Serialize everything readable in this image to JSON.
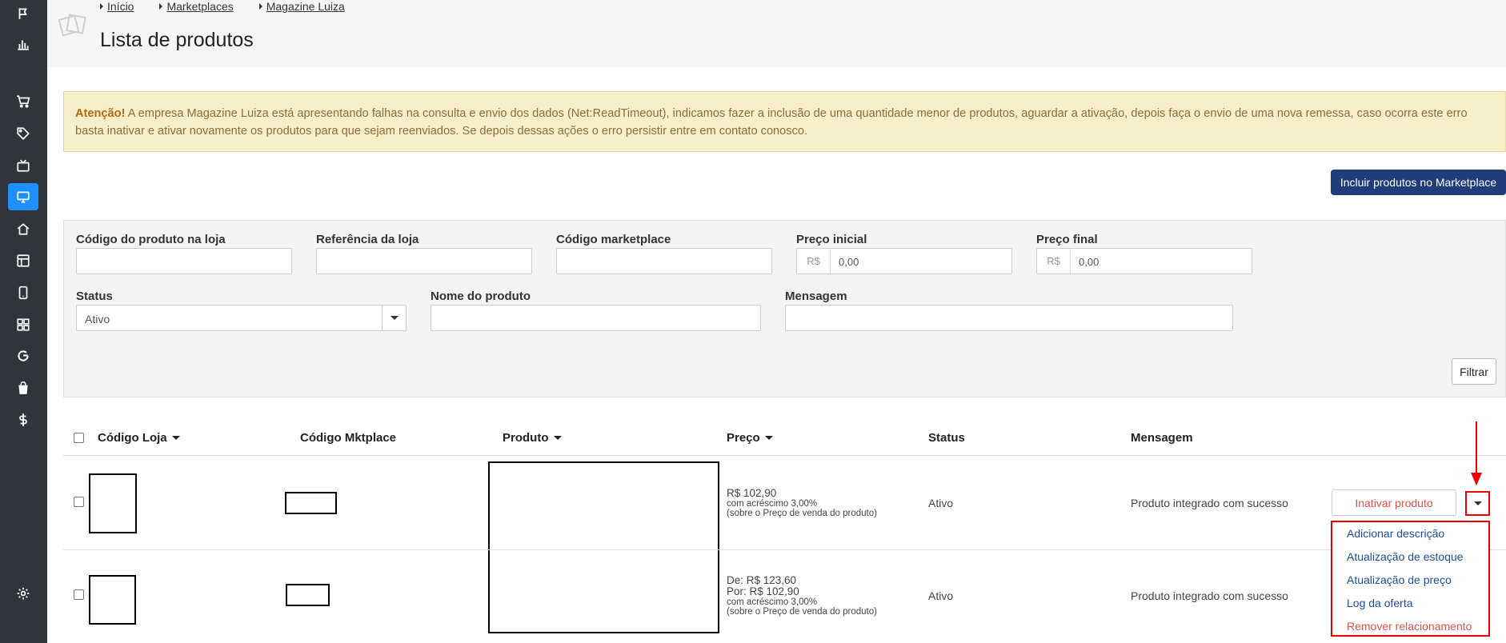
{
  "breadcrumb": [
    "Início",
    "Marketplaces",
    "Magazine Luiza"
  ],
  "page_title": "Lista de produtos",
  "alert": {
    "prefix": "Atenção!",
    "line1": "A empresa Magazine Luiza está apresentando falhas na consulta e envio dos dados (Net:ReadTimeout), indicamos fazer a inclusão de uma quantidade menor de produtos, aguardar a ativação, depois faça o envio de uma nova remessa, caso ocorra este erro",
    "line2": "basta inativar e ativar novamente os produtos para que sejam reenviados. Se depois dessas ações o erro persistir entre em contato conosco."
  },
  "include_button": "Incluir produtos no Marketplace",
  "filters": {
    "codigo_loja": "Código do produto na loja",
    "referencia": "Referência da loja",
    "codigo_mkt": "Código marketplace",
    "preco_inicial": "Preço inicial",
    "preco_final": "Preço final",
    "currency": "R$",
    "preco_inicial_value": "0,00",
    "preco_final_value": "0,00",
    "status": "Status",
    "status_value": "Ativo",
    "nome": "Nome do produto",
    "mensagem": "Mensagem",
    "filter_button": "Filtrar"
  },
  "table": {
    "headers": {
      "codigo_loja": "Código Loja",
      "codigo_mkt": "Código Mktplace",
      "produto": "Produto",
      "preco": "Preço",
      "status": "Status",
      "mensagem": "Mensagem"
    },
    "rows": [
      {
        "price_main": "R$ 102,90",
        "price_note1": "com acréscimo 3,00%",
        "price_note2": "(sobre o Preço de venda do produto)",
        "status": "Ativo",
        "mensagem": "Produto integrado com sucesso"
      },
      {
        "price_de": "De: R$ 123,60",
        "price_por": "Por: R$ 102,90",
        "price_note1": "com acréscimo 3,00%",
        "price_note2": "(sobre o Preço de venda do produto)",
        "status": "Ativo",
        "mensagem": "Produto integrado com sucesso"
      }
    ],
    "action_button": "Inativar produto",
    "dropdown": [
      "Adicionar descrição",
      "Atualização de estoque",
      "Atualização de preço",
      "Log da oferta",
      "Remover relacionamento"
    ]
  },
  "sidebar_icons": [
    "flag-icon",
    "bar-chart-icon",
    "cart-icon",
    "tag-icon",
    "tv-icon",
    "monitor-icon",
    "home-icon",
    "layout-icon",
    "mobile-icon",
    "grid-icon",
    "google-icon",
    "shopping-bag-icon",
    "dollar-icon",
    "gear-icon"
  ],
  "colors": {
    "sidebar": "#2f353a",
    "active": "#1e90ff",
    "primary": "#1f3d7a",
    "alert_bg": "#f7efc9",
    "danger": "#d9534f",
    "highlight": "#e00000"
  }
}
